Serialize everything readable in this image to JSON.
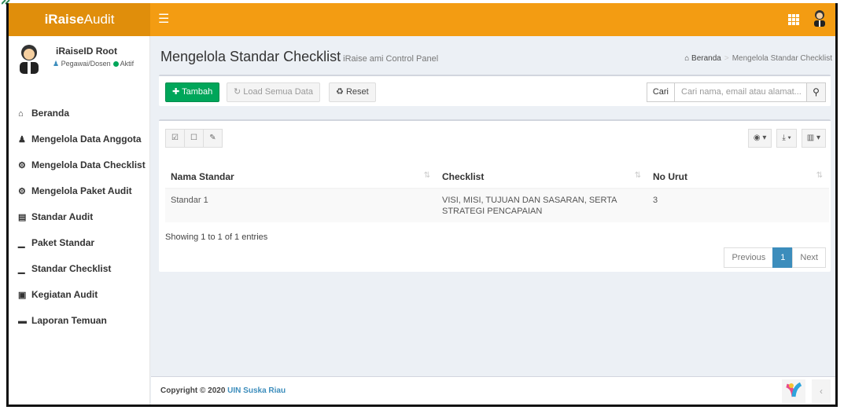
{
  "brand": {
    "bold": "iRaise",
    "rest": "Audit"
  },
  "user": {
    "name": "iRaiseID Root",
    "role": "Pegawai/Dosen",
    "status": "Aktif"
  },
  "menu": [
    {
      "icon": "home-icon",
      "glyph": "⌂",
      "label": "Beranda"
    },
    {
      "icon": "users-icon",
      "glyph": "♟",
      "label": "Mengelola Data Anggota"
    },
    {
      "icon": "cogs-icon",
      "glyph": "⚙",
      "label": "Mengelola Data Checklist"
    },
    {
      "icon": "cogs-icon",
      "glyph": "⚙",
      "label": "Mengelola Paket Audit"
    },
    {
      "icon": "book-icon",
      "glyph": "▤",
      "label": "Standar Audit"
    },
    {
      "icon": "bar-chart-icon",
      "glyph": "▁",
      "label": "Paket Standar"
    },
    {
      "icon": "bar-chart-icon",
      "glyph": "▁",
      "label": "Standar Checklist"
    },
    {
      "icon": "id-card-icon",
      "glyph": "▣",
      "label": "Kegiatan Audit"
    },
    {
      "icon": "folder-icon",
      "glyph": "▬",
      "label": "Laporan Temuan"
    }
  ],
  "page": {
    "title": "Mengelola Standar Checklist",
    "subtitle": "iRaise ami Control Panel"
  },
  "breadcrumb": {
    "home": "Beranda",
    "current": "Mengelola Standar Checklist"
  },
  "toolbar": {
    "add": "Tambah",
    "load": "Load Semua Data",
    "reset": "Reset"
  },
  "search": {
    "label": "Cari",
    "placeholder": "Cari nama, email atau alamat..."
  },
  "table": {
    "columns": [
      "Nama Standar",
      "Checklist",
      "No Urut"
    ],
    "rows": [
      [
        "Standar 1",
        "VISI, MISI, TUJUAN DAN SASARAN, SERTA STRATEGI PENCAPAIAN",
        "3"
      ]
    ]
  },
  "info": "Showing 1 to 1 of 1 entries",
  "pagination": {
    "prev": "Previous",
    "page": "1",
    "next": "Next"
  },
  "footer": {
    "prefix": "Copyright © 2020",
    "org": "UIN Suska Riau"
  },
  "colors": {
    "topbar": "#f39c12",
    "logo_bg": "#e08e0b",
    "primary": "#3c8dbc",
    "success": "#00a65a"
  }
}
